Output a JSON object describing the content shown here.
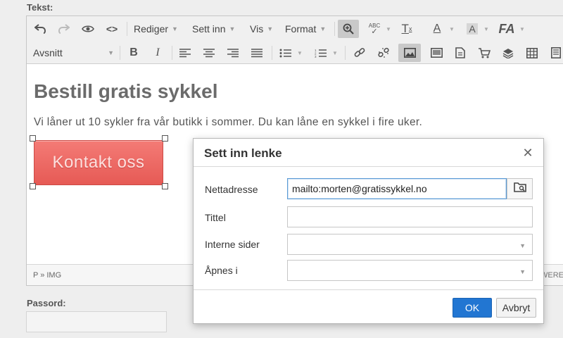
{
  "labels": {
    "text_field": "Tekst:",
    "password_field": "Passord:"
  },
  "toolbar": {
    "menus": {
      "edit": "Rediger",
      "insert": "Sett inn",
      "view": "Vis",
      "format": "Format"
    },
    "paragraph_select": "Avsnitt",
    "icons": [
      "undo-icon",
      "redo-icon",
      "preview-eye-icon",
      "source-code-icon",
      "zoom-icon",
      "spellcheck-icon",
      "clear-formatting-icon",
      "text-color-icon",
      "background-color-icon",
      "font-size-icon",
      "bold-icon",
      "italic-icon",
      "align-left-icon",
      "align-center-icon",
      "align-right-icon",
      "justify-icon",
      "bullet-list-icon",
      "numbered-list-icon",
      "link-icon",
      "unlink-icon",
      "image-icon",
      "media-icon",
      "template-icon",
      "shop-icon",
      "layers-icon",
      "table-icon"
    ]
  },
  "content": {
    "heading": "Bestill gratis sykkel",
    "paragraph": "Vi låner ut 10 sykler fra vår butikk i sommer. Du kan låne en sykkel i fire uker.",
    "button_label": "Kontakt oss"
  },
  "statusbar": {
    "path": "P » IMG",
    "brand": "WERE"
  },
  "dialog": {
    "title": "Sett inn lenke",
    "fields": {
      "url_label": "Nettadresse",
      "url_value": "mailto:morten@gratissykkel.no",
      "title_label": "Tittel",
      "title_value": "",
      "internal_label": "Interne sider",
      "internal_value": "",
      "open_label": "Åpnes i",
      "open_value": ""
    },
    "ok": "OK",
    "cancel": "Avbryt"
  },
  "colors": {
    "accent": "#2276d2",
    "cta": "#ee6a64",
    "focus": "#5b9bd5"
  }
}
